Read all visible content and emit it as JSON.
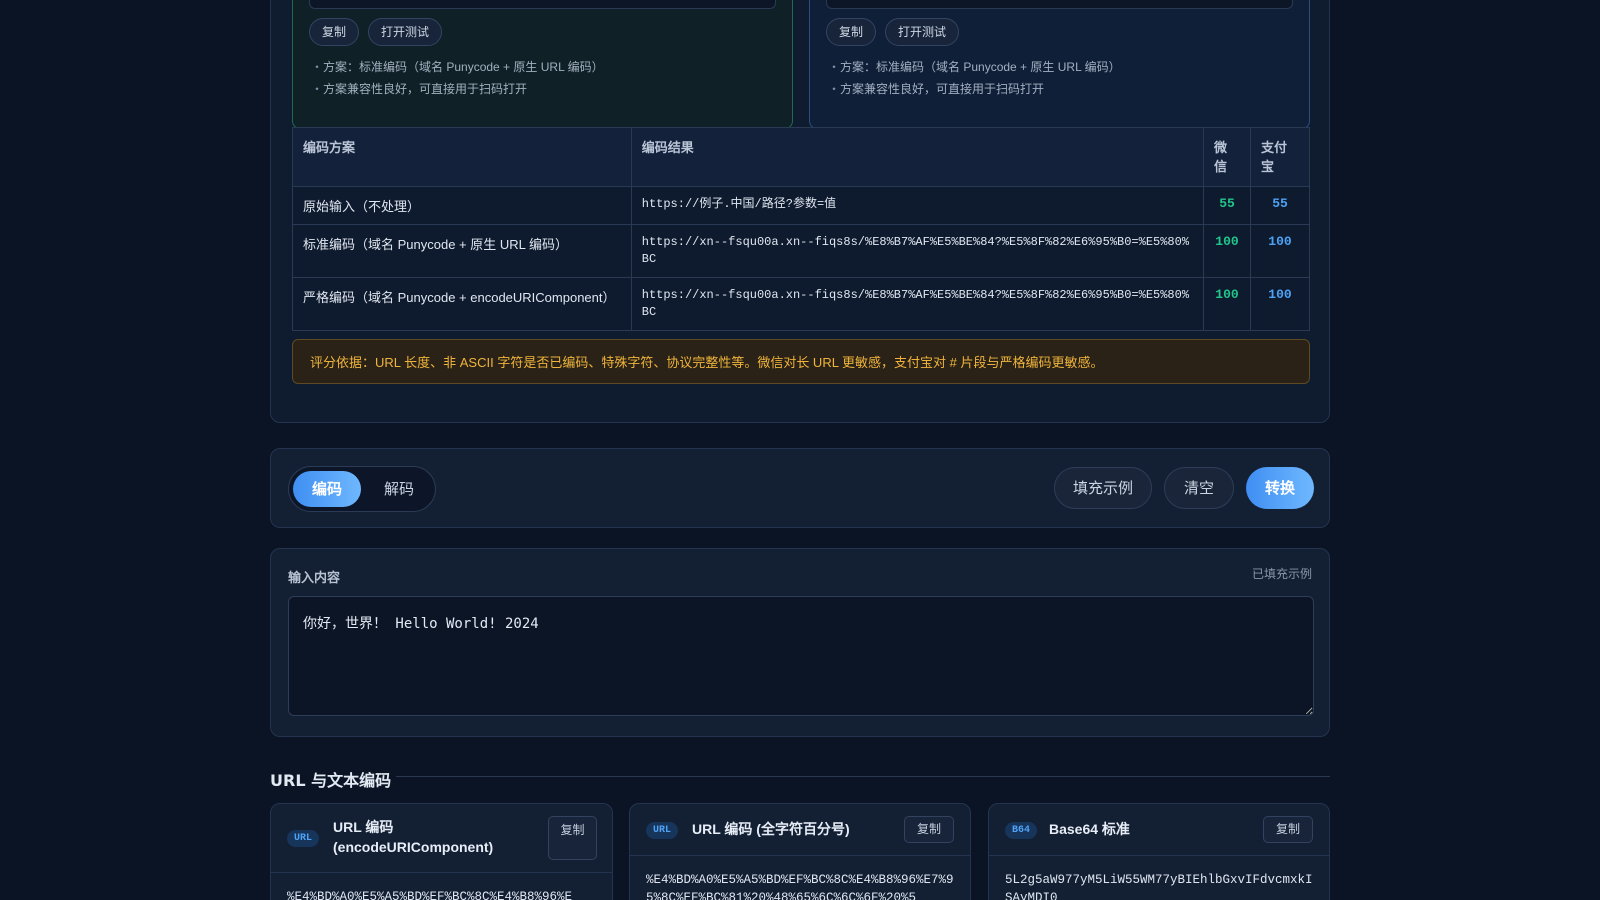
{
  "top_cards": [
    {
      "buttons": [
        "复制",
        "打开测试"
      ],
      "notes": [
        "方案：标准编码（域名 Punycode + 原生 URL 编码）",
        "方案兼容性良好，可直接用于扫码打开"
      ]
    },
    {
      "buttons": [
        "复制",
        "打开测试"
      ],
      "notes": [
        "方案：标准编码（域名 Punycode + 原生 URL 编码）",
        "方案兼容性良好，可直接用于扫码打开"
      ]
    }
  ],
  "table": {
    "headers": [
      "编码方案",
      "编码结果",
      "微信",
      "支付宝"
    ],
    "rows": [
      {
        "scheme": "原始输入（不处理）",
        "result": "https://例子.中国/路径?参数=值",
        "wechat": "55",
        "alipay": "55"
      },
      {
        "scheme": "标准编码（域名 Punycode + 原生 URL 编码）",
        "result": "https://xn--fsqu00a.xn--fiqs8s/%E8%B7%AF%E5%BE%84?%E5%8F%82%E6%95%B0=%E5%80%BC",
        "wechat": "100",
        "alipay": "100"
      },
      {
        "scheme": "严格编码（域名 Punycode + encodeURIComponent）",
        "result": "https://xn--fsqu00a.xn--fiqs8s/%E8%B7%AF%E5%BE%84?%E5%8F%82%E6%95%B0=%E5%80%BC",
        "wechat": "100",
        "alipay": "100"
      }
    ]
  },
  "notice": "评分依据：URL 长度、非 ASCII 字符是否已编码、特殊字符、协议完整性等。微信对长 URL 更敏感，支付宝对 # 片段与严格编码更敏感。",
  "toolbar": {
    "mode_encode": "编码",
    "mode_decode": "解码",
    "fill_example": "填充示例",
    "clear": "清空",
    "convert": "转换"
  },
  "input": {
    "label": "输入内容",
    "status": "已填充示例",
    "value": "你好，世界！ Hello World! 2024"
  },
  "section": {
    "title": "URL 与文本编码"
  },
  "results": [
    {
      "tag": "URL",
      "name": "URL 编码 (encodeURIComponent)",
      "copy": "复制",
      "value": "%E4%BD%A0%E5%A5%BD%EF%BC%8C%E4%B8%96%E"
    },
    {
      "tag": "URL",
      "name": "URL 编码 (全字符百分号)",
      "copy": "复制",
      "value": "%E4%BD%A0%E5%A5%BD%EF%BC%8C%E4%B8%96%E7%95%8C%EF%BC%81%20%48%65%6C%6C%6F%20%5"
    },
    {
      "tag": "B64",
      "name": "Base64 标准",
      "copy": "复制",
      "value": "5L2g5aW977yM5LiW55WM77yBIEhlbGxvIFdvcmxkISAyMDI0"
    }
  ],
  "colors": {
    "accent": "#4fa3f7",
    "wechat_score": "#22c58b",
    "alipay_score": "#4ea2f5",
    "notice": "#f0b43c"
  }
}
